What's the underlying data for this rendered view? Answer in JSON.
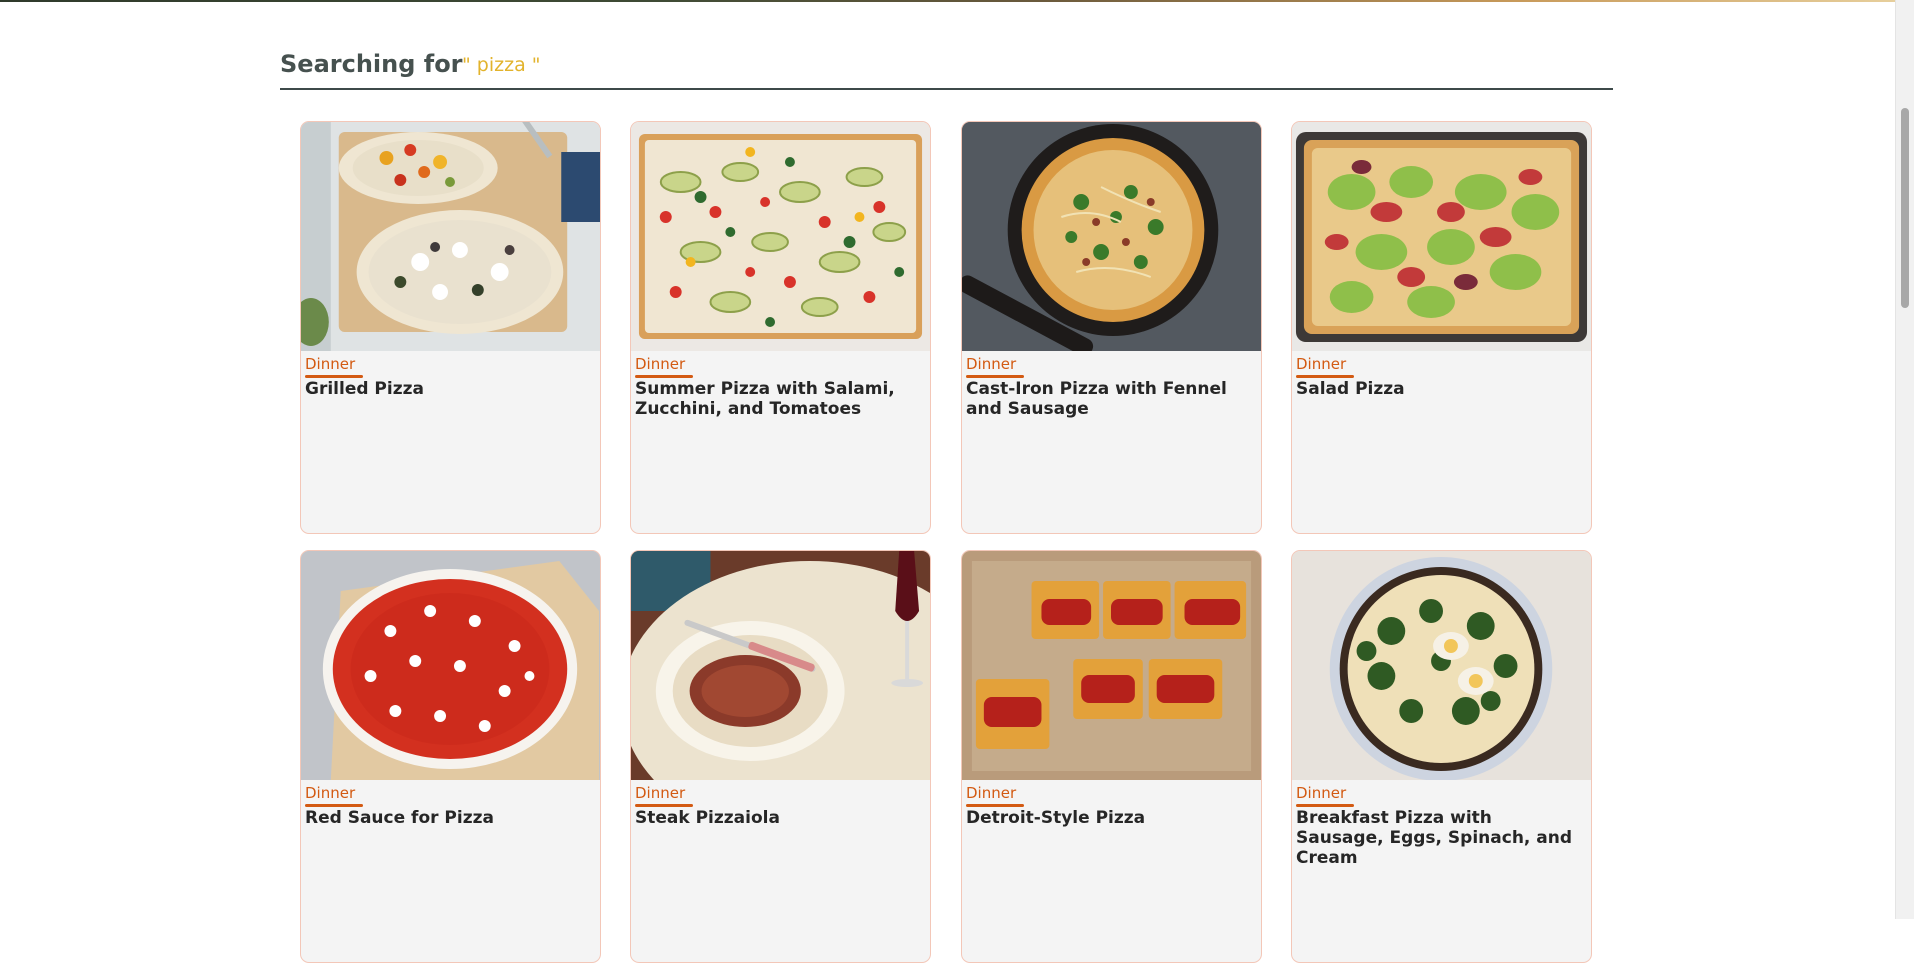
{
  "search": {
    "label": "Searching for",
    "term": "\" pizza \""
  },
  "cards": [
    {
      "tag": "Dinner",
      "title": "Grilled Pizza",
      "image": "grilled-pizza-photo"
    },
    {
      "tag": "Dinner",
      "title": "Summer Pizza with Salami, Zucchini, and Tomatoes",
      "image": "summer-pizza-photo"
    },
    {
      "tag": "Dinner",
      "title": "Cast-Iron Pizza with Fennel and Sausage",
      "image": "cast-iron-pizza-photo"
    },
    {
      "tag": "Dinner",
      "title": "Salad Pizza",
      "image": "salad-pizza-photo"
    },
    {
      "tag": "Dinner",
      "title": "Red Sauce for Pizza",
      "image": "red-sauce-pizza-photo"
    },
    {
      "tag": "Dinner",
      "title": "Steak Pizzaiola",
      "image": "steak-pizzaiola-photo"
    },
    {
      "tag": "Dinner",
      "title": "Detroit-Style Pizza",
      "image": "detroit-pizza-photo"
    },
    {
      "tag": "Dinner",
      "title": "Breakfast Pizza with Sausage, Eggs, Spinach, and Cream",
      "image": "breakfast-pizza-photo"
    }
  ],
  "colors": {
    "accent": "#d35a12",
    "search_term": "#e2b32c",
    "card_border": "#f3c7b8",
    "card_bg": "#f4f4f4"
  }
}
